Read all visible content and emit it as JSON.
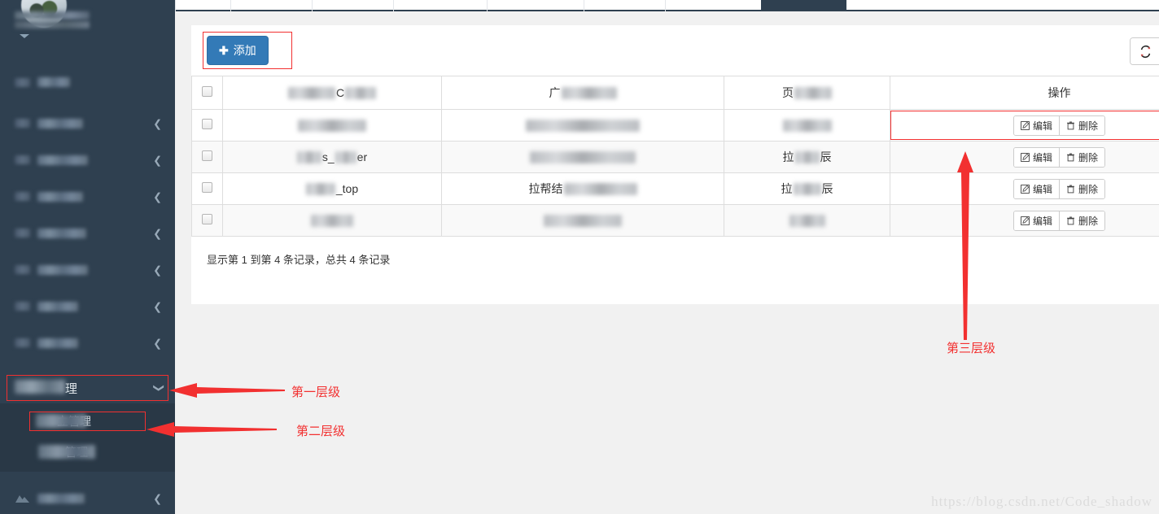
{
  "sidebar": {
    "profile": {
      "avatar_icon": "user-avatar-photo",
      "caret_icon": "caret-down-icon"
    },
    "items": [
      {
        "label": "",
        "has_chevron": false,
        "icon": "nav-icon"
      },
      {
        "label": "",
        "has_chevron": true,
        "icon": "nav-icon"
      },
      {
        "label": "",
        "has_chevron": true,
        "icon": "nav-icon"
      },
      {
        "label": "",
        "has_chevron": true,
        "icon": "nav-icon"
      },
      {
        "label": "",
        "has_chevron": true,
        "icon": "nav-icon"
      },
      {
        "label": "",
        "has_chevron": true,
        "icon": "nav-icon"
      },
      {
        "label": "",
        "has_chevron": true,
        "icon": "nav-icon"
      },
      {
        "label": "",
        "has_chevron": true,
        "icon": "nav-icon"
      }
    ],
    "parent_menu": {
      "label": "理",
      "chevron_icon": "chevron-down-icon"
    },
    "submenu": [
      {
        "label": "立管理"
      },
      {
        "label": "管理"
      }
    ],
    "bottom_item": {
      "label": "",
      "chevron_icon": "chevron-left-icon",
      "icon": "mountain-icon"
    }
  },
  "toolbar": {
    "add_label": "添加",
    "add_icon": "plus-icon",
    "icons": [
      "refresh-icon",
      "list-toggle-icon",
      "columns-grid-icon"
    ]
  },
  "table": {
    "headers": [
      "",
      "",
      "",
      "",
      "操作"
    ],
    "rows": [
      {
        "checkbox": false,
        "col_a": {
          "blur_w": 100,
          "visible": "C"
        },
        "col_b": {
          "blur_w": 120,
          "visible": "广"
        },
        "col_c": {
          "blur_w": 65,
          "visible": "页"
        },
        "is_header_like": true
      },
      {
        "checkbox": false,
        "col_a": {
          "blur_w": 84,
          "visible": ""
        },
        "col_b": {
          "blur_w": 140,
          "visible": ""
        },
        "col_c": {
          "blur_w": 60,
          "visible": ""
        },
        "edit_label": "编辑",
        "delete_label": "删除"
      },
      {
        "checkbox": false,
        "col_a": {
          "blur_w": 45,
          "visible": "s_    er"
        },
        "col_b": {
          "blur_w": 130,
          "visible": ""
        },
        "col_c": {
          "blur_w": 45,
          "visible": "拉      辰"
        },
        "edit_label": "编辑",
        "delete_label": "删除"
      },
      {
        "checkbox": false,
        "col_a": {
          "blur_w": 40,
          "visible": "_top"
        },
        "col_b": {
          "blur_w": 110,
          "visible": "拉帮结"
        },
        "col_c": {
          "blur_w": 45,
          "visible": "拉      辰"
        },
        "edit_label": "编辑",
        "delete_label": "删除"
      },
      {
        "checkbox": false,
        "col_a": {
          "blur_w": 52,
          "visible": ""
        },
        "col_b": {
          "blur_w": 96,
          "visible": ""
        },
        "col_c": {
          "blur_w": 44,
          "visible": ""
        },
        "edit_label": "编辑",
        "delete_label": "删除"
      }
    ],
    "edit_icon": "pencil-square-icon",
    "delete_icon": "trash-icon",
    "footer_text": "显示第 1 到第 4 条记录，总共 4 条记录"
  },
  "annotations": {
    "level1": "第一层级",
    "level2": "第二层级",
    "level3": "第三层级",
    "color": "#f23030"
  },
  "watermark": "https://blog.csdn.net/Code_shadow"
}
